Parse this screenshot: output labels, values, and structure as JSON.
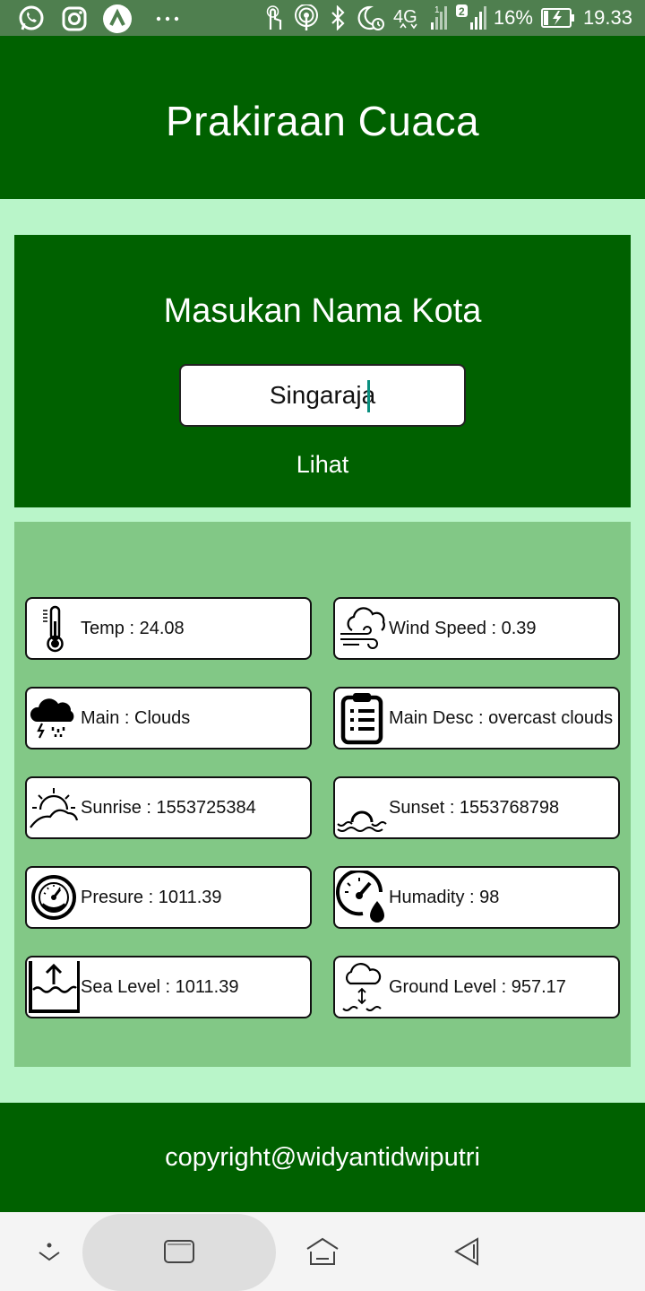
{
  "status_bar": {
    "battery_percent": "16%",
    "time": "19.33",
    "network": "4G",
    "sim_badge": "2",
    "notification_icons": [
      "whatsapp-icon",
      "instagram-icon",
      "app-icon",
      "more-dots-icon"
    ],
    "system_icons": [
      "touch-icon",
      "hotspot-icon",
      "bluetooth-icon",
      "do-not-disturb-alarm-icon",
      "signal-4g-icon",
      "signal-icon",
      "battery-icon"
    ]
  },
  "header": {
    "title": "Prakiraan Cuaca"
  },
  "search": {
    "title": "Masukan Nama Kota",
    "city_value": "Singaraja",
    "submit_label": "Lihat"
  },
  "weather": {
    "temp": "Temp : 24.08",
    "wind_speed": "Wind Speed : 0.39",
    "main": "Main : Clouds",
    "main_desc": "Main Desc : overcast clouds",
    "sunrise": "Sunrise : 1553725384",
    "sunset": "Sunset : 1553768798",
    "pressure": "Presure : 1011.39",
    "humidity": "Humadity : 98",
    "sea_level": "Sea Level : 1011.39",
    "ground_level": "Ground Level : 957.17"
  },
  "footer": {
    "copyright": "copyright@widyantidwiputri"
  },
  "colors": {
    "dark_green": "#006100",
    "mint_background": "#b9f5c9",
    "results_green": "#82c886",
    "status_strip": "#4f7f4f"
  }
}
